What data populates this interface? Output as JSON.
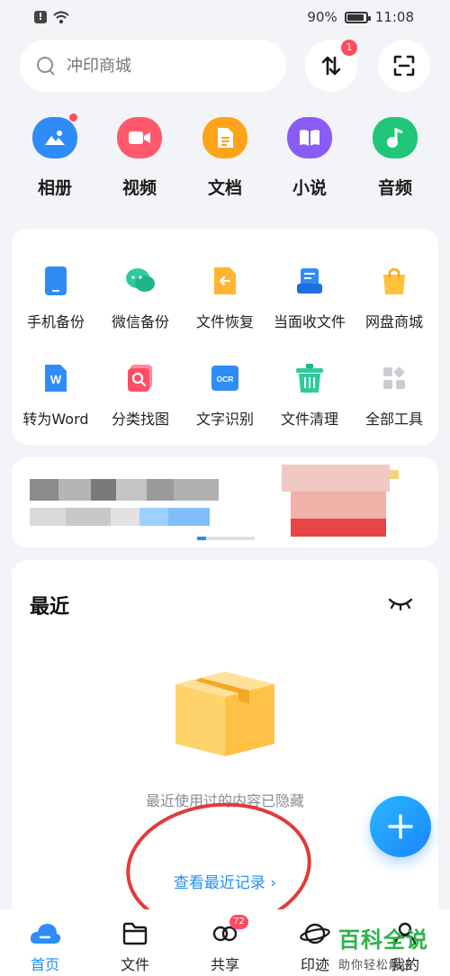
{
  "status_bar": {
    "battery": "90%",
    "battery_level": 0.9,
    "time": "11:08"
  },
  "search": {
    "placeholder": "冲印商城"
  },
  "transfer": {
    "badge": "1"
  },
  "categories": [
    {
      "label": "相册",
      "icon": "photo-album-icon",
      "color": "#2f8cf7"
    },
    {
      "label": "视频",
      "icon": "video-icon",
      "color": "#ff5a6b"
    },
    {
      "label": "文档",
      "icon": "document-icon",
      "color": "#ffa31a"
    },
    {
      "label": "小说",
      "icon": "book-icon",
      "color": "#8a5cf5"
    },
    {
      "label": "音频",
      "icon": "music-icon",
      "color": "#20c77a"
    }
  ],
  "tools": [
    {
      "label": "手机备份",
      "icon": "phone-backup-icon"
    },
    {
      "label": "微信备份",
      "icon": "wechat-backup-icon"
    },
    {
      "label": "文件恢复",
      "icon": "file-restore-icon"
    },
    {
      "label": "当面收文件",
      "icon": "receive-files-icon"
    },
    {
      "label": "网盘商城",
      "icon": "shop-bag-icon"
    },
    {
      "label": "转为Word",
      "icon": "word-convert-icon"
    },
    {
      "label": "分类找图",
      "icon": "image-search-icon"
    },
    {
      "label": "文字识别",
      "icon": "ocr-icon"
    },
    {
      "label": "文件清理",
      "icon": "trash-clean-icon"
    },
    {
      "label": "全部工具",
      "icon": "all-tools-icon"
    }
  ],
  "ocr_text": "OCR",
  "word_letter": "W",
  "recent": {
    "title": "最近",
    "hidden_text": "最近使用过的内容已隐藏",
    "view_link": "查看最近记录 ›"
  },
  "bottom_nav": [
    {
      "label": "首页",
      "icon": "home-cloud-icon",
      "active": true
    },
    {
      "label": "文件",
      "icon": "folder-icon",
      "active": false
    },
    {
      "label": "共享",
      "icon": "share-icon",
      "active": false,
      "badge": "72"
    },
    {
      "label": "印迹",
      "icon": "planet-icon",
      "active": false
    },
    {
      "label": "我的",
      "icon": "profile-icon",
      "active": false
    }
  ],
  "watermark": {
    "title": "百科全说",
    "subtitle": "助你轻松解决"
  }
}
